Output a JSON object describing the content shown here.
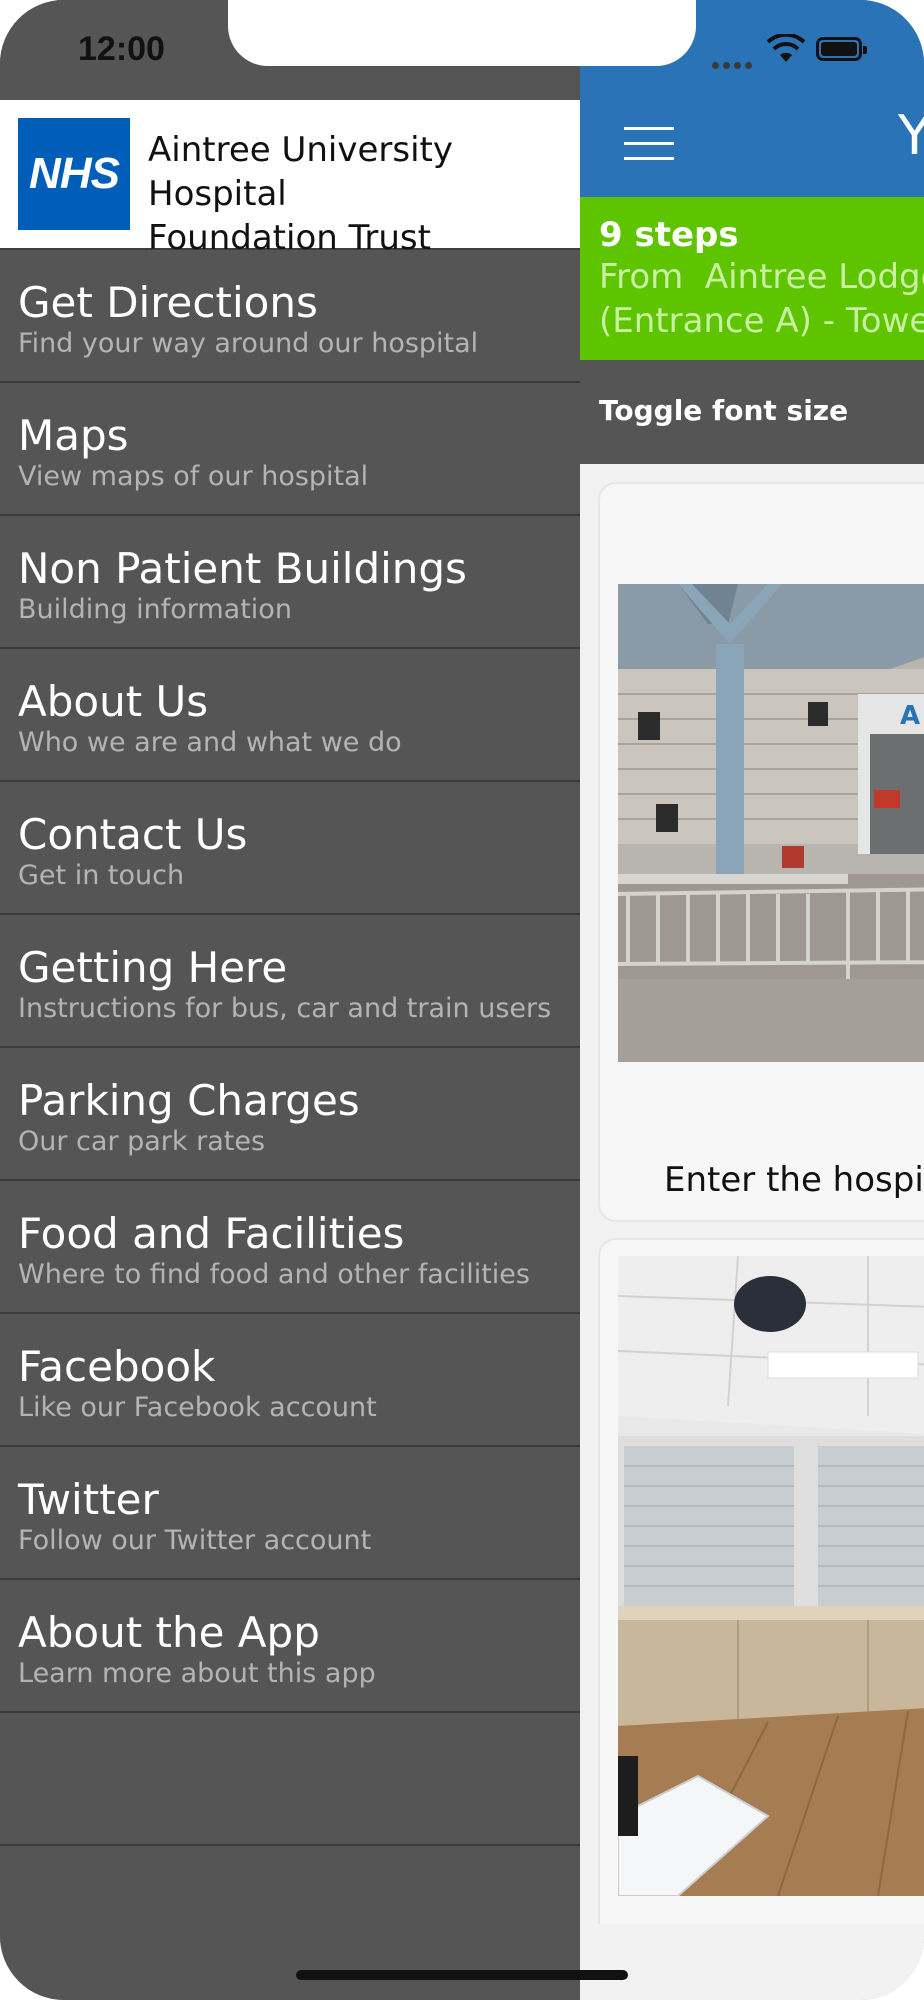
{
  "status_bar": {
    "time": "12:00"
  },
  "drawer": {
    "logo_text": "NHS",
    "trust_name_line1": "Aintree University Hospital",
    "trust_name_line2": "Foundation Trust",
    "items": [
      {
        "title": "Get Directions",
        "subtitle": "Find your way around our hospital"
      },
      {
        "title": "Maps",
        "subtitle": "View maps of our hospital"
      },
      {
        "title": "Non Patient Buildings",
        "subtitle": "Building information"
      },
      {
        "title": "About Us",
        "subtitle": "Who we are and what we do"
      },
      {
        "title": "Contact Us",
        "subtitle": "Get in touch"
      },
      {
        "title": "Getting Here",
        "subtitle": "Instructions for bus, car and train users"
      },
      {
        "title": "Parking Charges",
        "subtitle": "Our car park rates"
      },
      {
        "title": "Food and Facilities",
        "subtitle": "Where to find food and other facilities"
      },
      {
        "title": "Facebook",
        "subtitle": "Like our Facebook account"
      },
      {
        "title": "Twitter",
        "subtitle": "Follow our Twitter account"
      },
      {
        "title": "About the App",
        "subtitle": "Learn more about this app"
      }
    ]
  },
  "content": {
    "appbar_title_partial": "Y",
    "steps_count": "9 steps",
    "route_line1": "From  Aintree Lodge",
    "route_line2": "(Entrance A) - Tower",
    "toggle_font_size": "Toggle font size",
    "cards": [
      {
        "caption": "Enter the hospita"
      },
      {
        "caption": ""
      }
    ]
  },
  "colors": {
    "drawer_bg": "#555555",
    "appbar_blue": "#2b73b7",
    "steps_green": "#5ec400",
    "nhs_blue": "#005eb8"
  }
}
